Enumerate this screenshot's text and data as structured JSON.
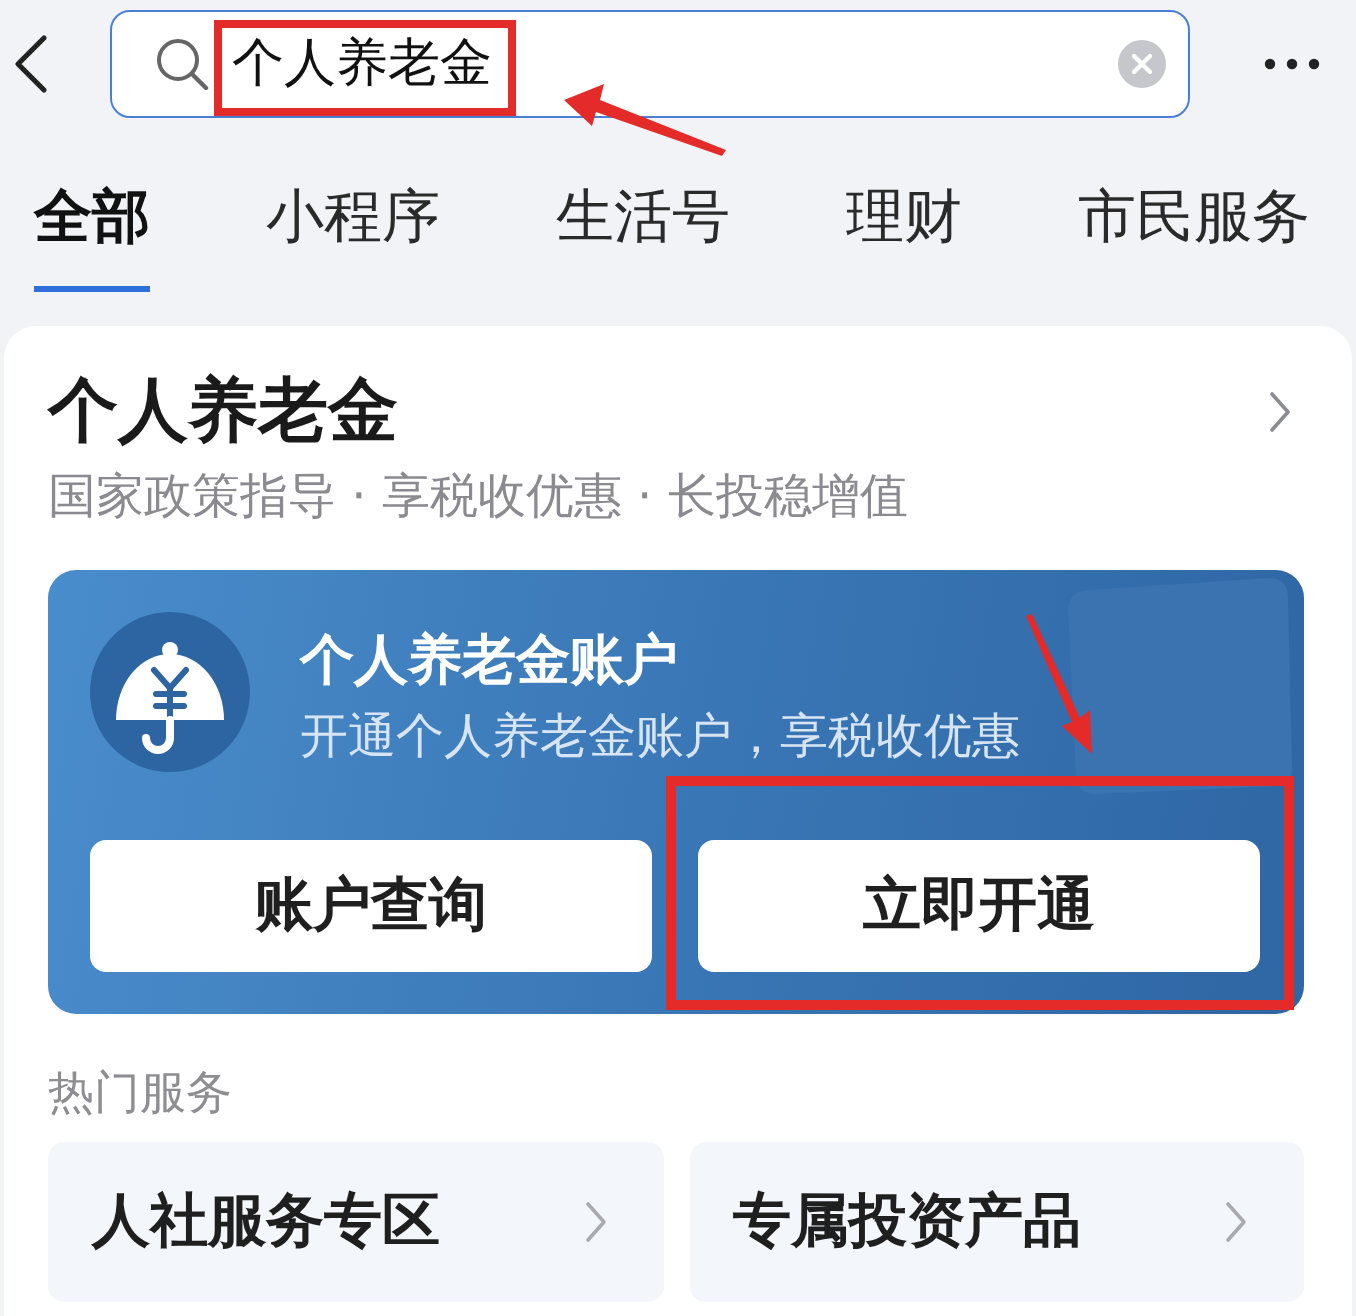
{
  "search": {
    "value": "个人养老金",
    "highlighted": true
  },
  "tabs": [
    {
      "label": "全部",
      "selected": true
    },
    {
      "label": "小程序",
      "selected": false
    },
    {
      "label": "生活号",
      "selected": false
    },
    {
      "label": "理财",
      "selected": false
    },
    {
      "label": "市民服务",
      "selected": false
    }
  ],
  "result_card": {
    "title": "个人养老金",
    "subtitle": "国家政策指导 · 享税收优惠 · 长投稳增值",
    "account_panel": {
      "title": "个人养老金账户",
      "description": "开通个人养老金账户，享税收优惠",
      "buttons": [
        {
          "label": "账户查询",
          "highlighted": false
        },
        {
          "label": "立即开通",
          "highlighted": true
        }
      ]
    },
    "hot_services": {
      "heading": "热门服务",
      "items": [
        {
          "label": "人社服务专区"
        },
        {
          "label": "专属投资产品"
        }
      ]
    }
  }
}
